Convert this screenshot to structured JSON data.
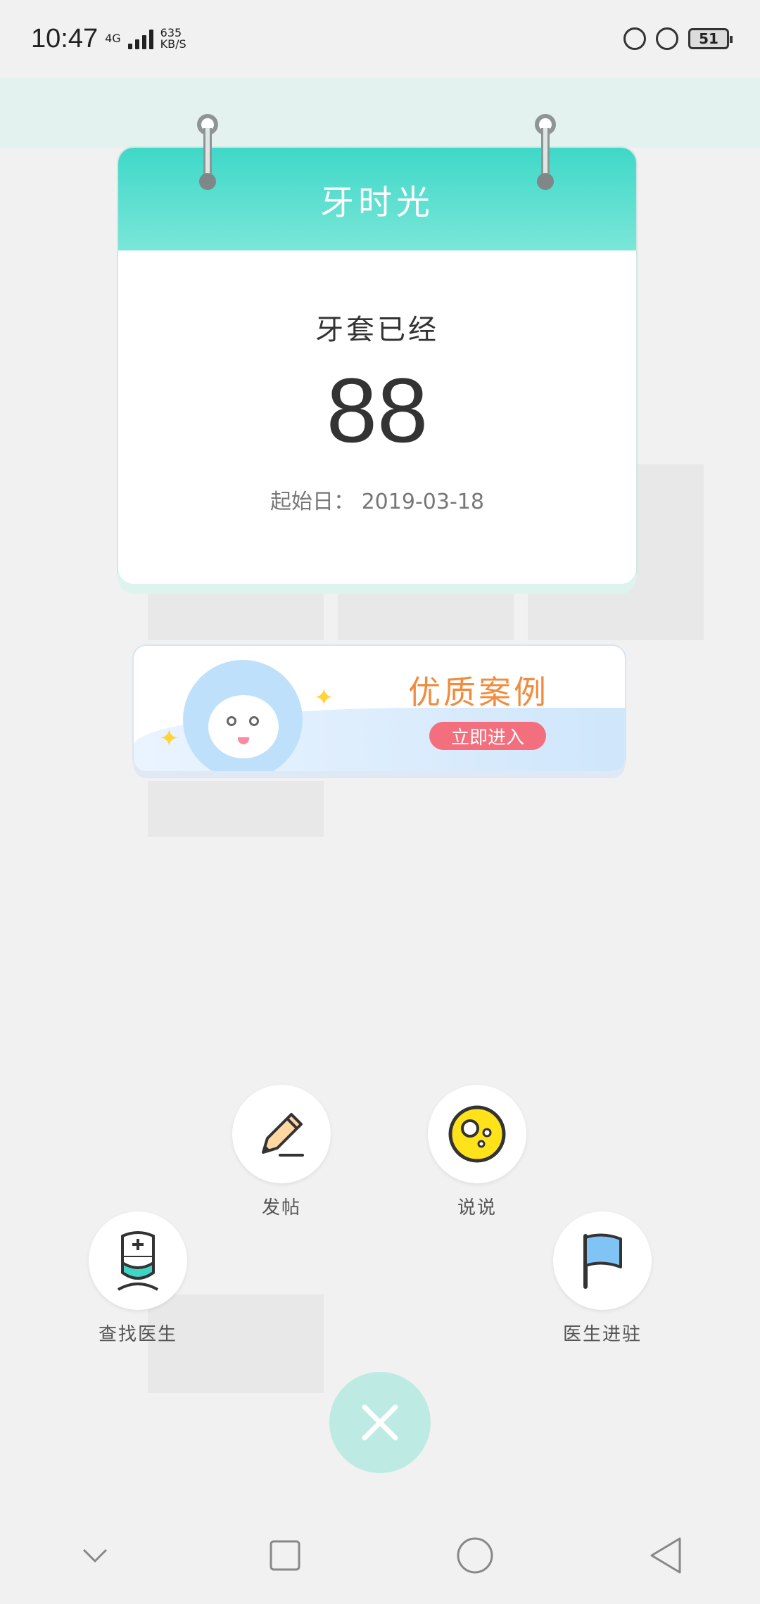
{
  "status_bar": {
    "time": "10:47",
    "network": "4G",
    "network_speed_value": "635",
    "network_speed_unit": "KB/S",
    "battery": "51",
    "icons": [
      "lock-rotation-icon",
      "alarm-icon",
      "battery-icon"
    ]
  },
  "calendar": {
    "title": "牙时光",
    "subtitle": "牙套已经",
    "days": "88",
    "start_date_label": "起始日：",
    "start_date": "2019-03-18"
  },
  "banner": {
    "title": "优质案例",
    "button": "立即进入"
  },
  "actions": {
    "post": "发帖",
    "talk": "说说",
    "find_doctor": "查找医生",
    "doctor_join": "医生进驻"
  },
  "colors": {
    "accent": "#3fd8c8",
    "banner_title": "#f28b3d",
    "banner_button": "#f36f7d",
    "close_button": "#bdebe3"
  }
}
